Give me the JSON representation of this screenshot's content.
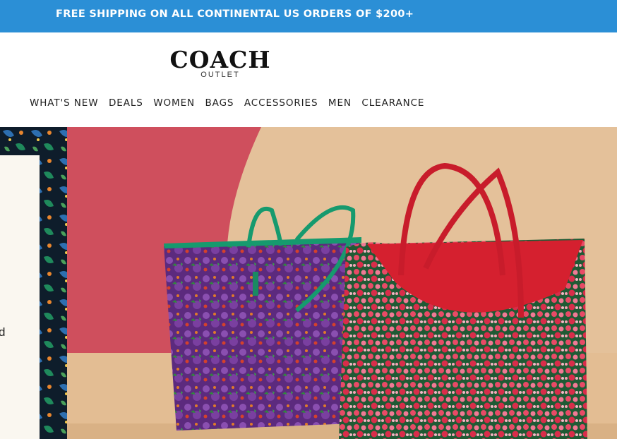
{
  "promo": {
    "text": "FREE SHIPPING ON ALL CONTINENTAL US ORDERS OF $200+"
  },
  "logo": {
    "brand": "COACH",
    "sub": "OUTLET"
  },
  "nav": {
    "items": [
      {
        "label": "WHAT'S NEW"
      },
      {
        "label": "DEALS"
      },
      {
        "label": "WOMEN"
      },
      {
        "label": "BAGS"
      },
      {
        "label": "ACCESSORIES"
      },
      {
        "label": "MEN"
      },
      {
        "label": "CLEARANCE"
      }
    ]
  },
  "hero": {
    "partial_text": "d",
    "colors": {
      "wall": "#e8c9a3",
      "backdrop": "#cf4f5d",
      "strap_green": "#169a6e",
      "bag_red": "#d5202f",
      "bag_purple": "#5c2a7e"
    }
  }
}
